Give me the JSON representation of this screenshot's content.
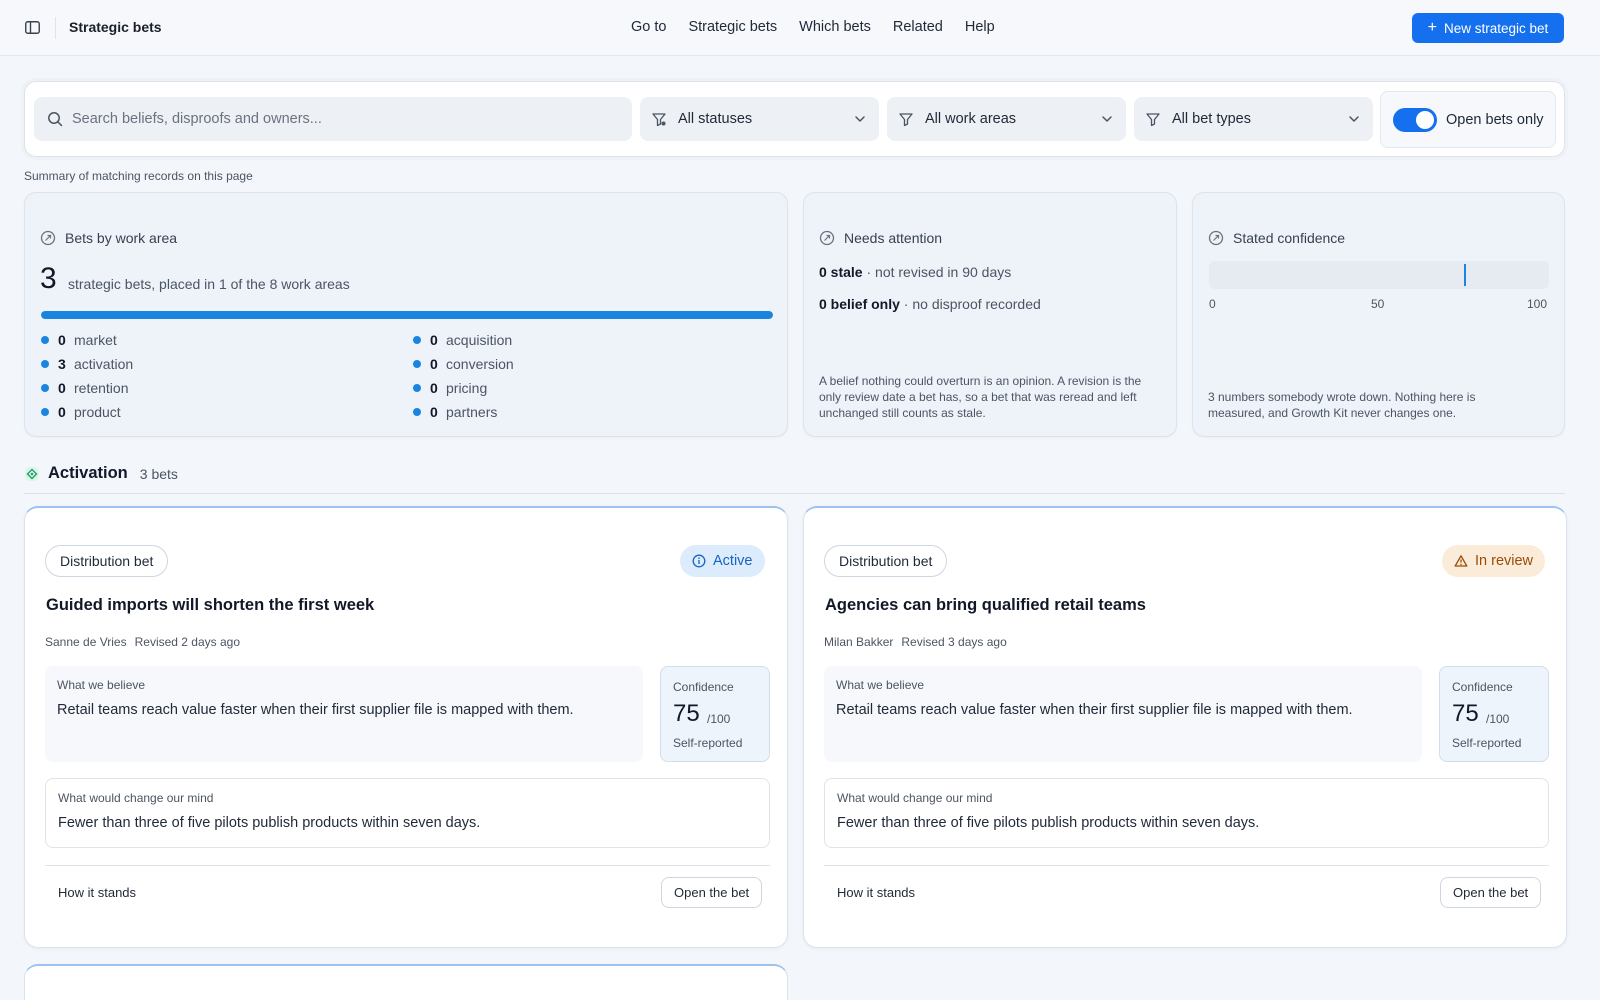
{
  "app": {
    "title": "Strategic bets"
  },
  "nav": [
    "Go to",
    "Strategic bets",
    "Which bets",
    "Related",
    "Help"
  ],
  "actions": {
    "new_bet": "New strategic bet"
  },
  "filters": {
    "search_placeholder": "Search beliefs, disproofs and owners...",
    "status": "All statuses",
    "work_area": "All work areas",
    "bet_type": "All bet types",
    "open_only_label": "Open bets only",
    "open_only": true
  },
  "summary_caption": "Summary of matching records on this page",
  "by_area": {
    "title": "Bets by work area",
    "count": "3",
    "count_text": "strategic bets, placed in 1 of the 8 work areas",
    "fill_fraction": 1.0,
    "areas": [
      {
        "count": "0",
        "name": "market"
      },
      {
        "count": "3",
        "name": "activation"
      },
      {
        "count": "0",
        "name": "retention"
      },
      {
        "count": "0",
        "name": "product"
      },
      {
        "count": "0",
        "name": "acquisition"
      },
      {
        "count": "0",
        "name": "conversion"
      },
      {
        "count": "0",
        "name": "pricing"
      },
      {
        "count": "0",
        "name": "partners"
      }
    ]
  },
  "attention": {
    "title": "Needs attention",
    "stale_count": "0 stale",
    "stale_text": " · not revised in 90 days",
    "belief_count": "0 belief only",
    "belief_text": " · no disproof recorded",
    "note": "A belief nothing could overturn is an opinion. A revision is the only review date a bet has, so a bet that was reread and left unchanged still counts as stale."
  },
  "confidence": {
    "title": "Stated confidence",
    "marker_value": 75,
    "ticks": [
      "0",
      "50",
      "100"
    ],
    "note": "3 numbers somebody wrote down. Nothing here is measured, and Growth Kit never changes one."
  },
  "section": {
    "title": "Activation",
    "count": "3 bets"
  },
  "bets": [
    {
      "type": "Distribution bet",
      "status": "Active",
      "title": "Guided imports will shorten the first week",
      "owner": "Sanne de Vries",
      "revised": "Revised 2 days ago",
      "believe_label": "What we believe",
      "believe": "Retail teams reach value faster when their first supplier file is mapped with them.",
      "confidence_label": "Confidence",
      "confidence": "75",
      "confidence_den": "/100",
      "confidence_source": "Self-reported",
      "mind_label": "What would change our mind",
      "mind": "Fewer than three of five pilots publish products within seven days.",
      "stands": "How it stands",
      "open": "Open the bet"
    },
    {
      "type": "Distribution bet",
      "status": "In review",
      "title": "Agencies can bring qualified retail teams",
      "owner": "Milan Bakker",
      "revised": "Revised 3 days ago",
      "believe_label": "What we believe",
      "believe": "Retail teams reach value faster when their first supplier file is mapped with them.",
      "confidence_label": "Confidence",
      "confidence": "75",
      "confidence_den": "/100",
      "confidence_source": "Self-reported",
      "mind_label": "What would change our mind",
      "mind": "Fewer than three of five pilots publish products within seven days.",
      "stands": "How it stands",
      "open": "Open the bet"
    }
  ],
  "colors": {
    "accent": "#1570ef",
    "bar": "#1a84e0",
    "active_bg": "#dcecfc",
    "review_bg": "#fbecd9"
  },
  "icons": [
    "sidebar-toggle-icon",
    "plus-icon",
    "search-icon",
    "filter-icon",
    "chevron-down-icon",
    "target-icon",
    "status-info-icon",
    "warning-icon",
    "activation-icon"
  ]
}
